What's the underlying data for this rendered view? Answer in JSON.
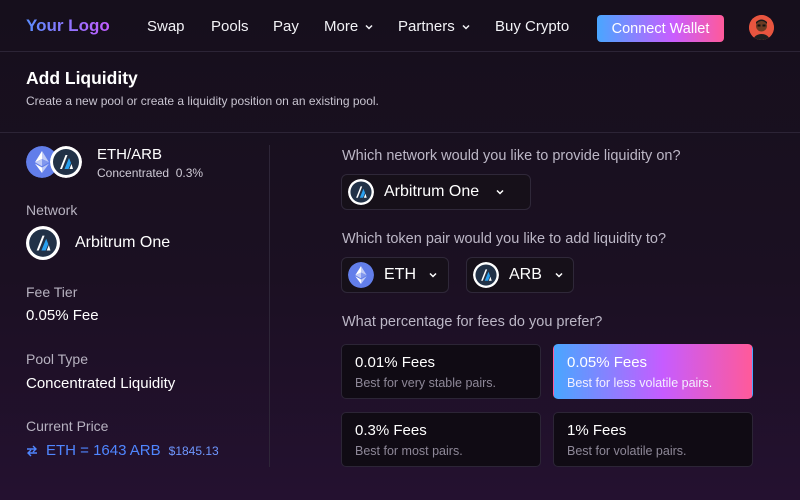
{
  "nav": {
    "logo": "Your Logo",
    "items": [
      {
        "label": "Swap",
        "dropdown": false
      },
      {
        "label": "Pools",
        "dropdown": false
      },
      {
        "label": "Pay",
        "dropdown": false
      },
      {
        "label": "More",
        "dropdown": true
      },
      {
        "label": "Partners",
        "dropdown": true
      },
      {
        "label": "Buy Crypto",
        "dropdown": false
      }
    ],
    "connect_label": "Connect Wallet"
  },
  "header": {
    "title": "Add Liquidity",
    "subtitle": "Create a new pool or create a liquidity position on an existing pool."
  },
  "summary": {
    "pair_name": "ETH/ARB",
    "pair_type": "Concentrated",
    "pair_fee": "0.3%",
    "network_label": "Network",
    "network_value": "Arbitrum One",
    "fee_tier_label": "Fee Tier",
    "fee_tier_value": "0.05% Fee",
    "pool_type_label": "Pool Type",
    "pool_type_value": "Concentrated Liquidity",
    "price_label": "Current Price",
    "price_value": "ETH = 1643 ARB",
    "price_usd": "$1845.13"
  },
  "form": {
    "network_question": "Which network would you like to provide liquidity on?",
    "network_selected": "Arbitrum One",
    "pair_question": "Which token pair would you like to add liquidity to?",
    "token_a": "ETH",
    "token_b": "ARB",
    "fee_question": "What percentage for fees do you prefer?",
    "fees": [
      {
        "title": "0.01% Fees",
        "desc": "Best for very stable pairs.",
        "selected": false
      },
      {
        "title": "0.05% Fees",
        "desc": "Best for less volatile pairs.",
        "selected": true
      },
      {
        "title": "0.3% Fees",
        "desc": "Best for most pairs.",
        "selected": false
      },
      {
        "title": "1% Fees",
        "desc": "Best for volatile pairs.",
        "selected": false
      }
    ]
  },
  "colors": {
    "accent_blue": "#4f86ff",
    "gradient_start": "#49a6ff",
    "gradient_end": "#ff5a9a",
    "eth": "#627eea",
    "arbitrum": "#2d374b"
  },
  "icons": {
    "eth": "ethereum-icon",
    "arb": "arbitrum-icon",
    "swap": "swap-arrows-icon",
    "chevron": "chevron-down-icon"
  }
}
